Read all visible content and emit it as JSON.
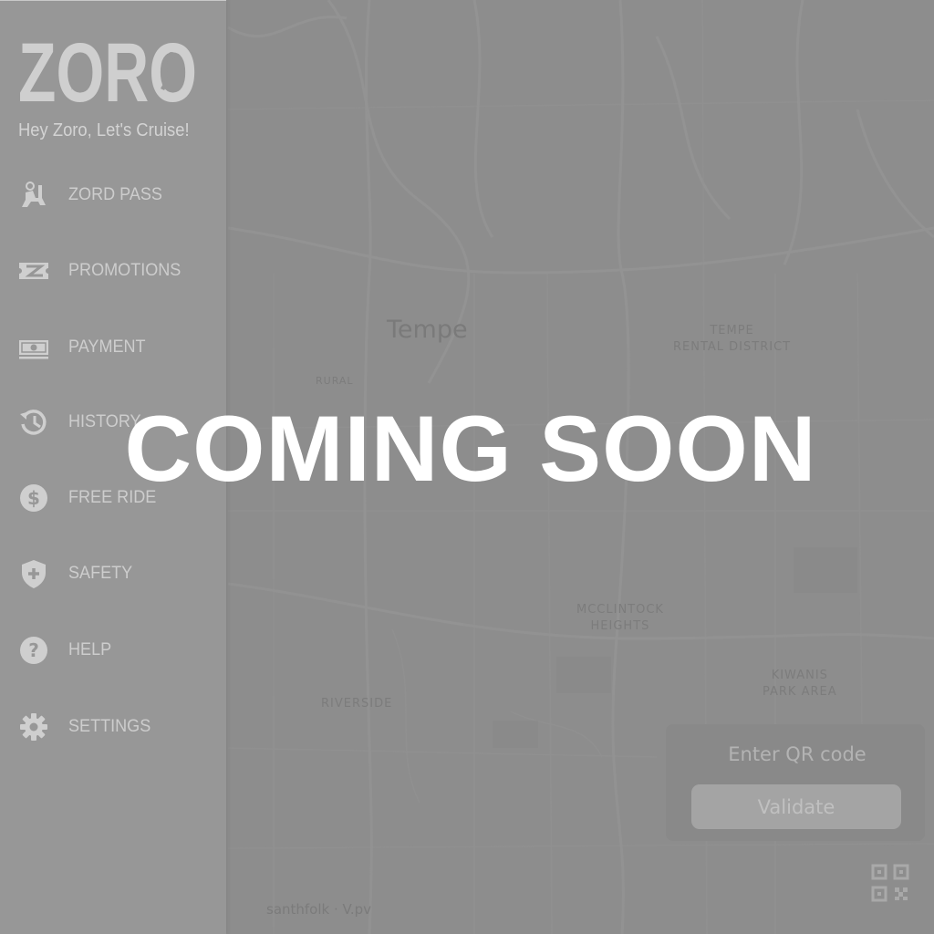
{
  "app": {
    "brand": "ZORO",
    "greeting": "Hey Zoro, Let's Cruise!"
  },
  "menu": [
    {
      "label": "ZORD PASS",
      "icon": "scooter-rider-icon"
    },
    {
      "label": "PROMOTIONS",
      "icon": "ticket-icon"
    },
    {
      "label": "PAYMENT",
      "icon": "cash-icon"
    },
    {
      "label": "HISTORY",
      "icon": "history-icon"
    },
    {
      "label": "FREE RIDE",
      "icon": "dollar-icon"
    },
    {
      "label": "SAFETY",
      "icon": "shield-plus-icon"
    },
    {
      "label": "HELP",
      "icon": "help-icon"
    },
    {
      "label": "SETTINGS",
      "icon": "gear-icon"
    }
  ],
  "map": {
    "labels": {
      "tempe": "Tempe",
      "north_line1": "TEMPE",
      "north_line2": "RENTAL DISTRICT",
      "mid_line1": "MCCLINTOCK",
      "mid_line2": "HEIGHTS",
      "southeast_line1": "KIWANIS",
      "southeast_line2": "PARK AREA",
      "southwest": "RIVERSIDE",
      "small": "RURAL"
    },
    "attribution": "santhfolk · V.pv"
  },
  "qr": {
    "placeholder": "Enter QR code",
    "validate_label": "Validate"
  },
  "overlay": {
    "text": "COMING SOON"
  },
  "colors": {
    "overlay_text": "#ffffff",
    "sidebar": "#979797",
    "map": "#8d8d8d"
  }
}
